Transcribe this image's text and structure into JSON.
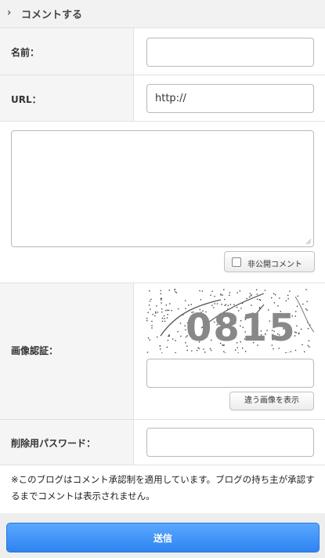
{
  "header": {
    "title": "コメントする"
  },
  "form": {
    "name_label": "名前：",
    "name_value": "",
    "url_label": "URL：",
    "url_value": "http://",
    "comment_value": "",
    "private_label": "非公開コメント",
    "captcha_label": "画像認証：",
    "captcha_text": "0815",
    "captcha_value": "",
    "captcha_refresh_label": "違う画像を表示",
    "password_label": "削除用パスワード：",
    "password_value": ""
  },
  "notice": "※このブログはコメント承認制を適用しています。ブログの持ち主が承認するまでコメントは表示されません。",
  "submit_label": "送信"
}
